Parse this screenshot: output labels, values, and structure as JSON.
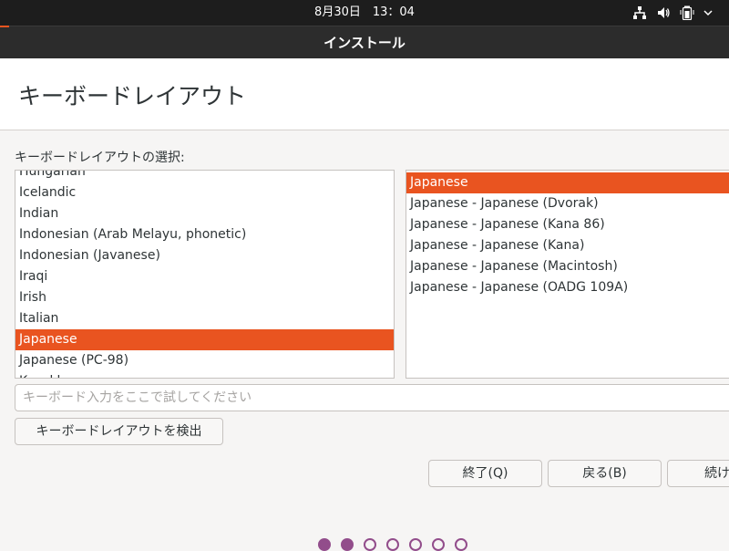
{
  "topbar": {
    "clock": "8月30日　13：04",
    "icons": [
      "network-icon",
      "volume-icon",
      "battery-icon",
      "chevron-down-icon"
    ]
  },
  "window": {
    "title": "インストール"
  },
  "page": {
    "title": "キーボードレイアウト"
  },
  "layout_section": {
    "label": "キーボードレイアウトの選択:"
  },
  "layout_list": {
    "items": [
      {
        "label": "Hungarian"
      },
      {
        "label": "Icelandic"
      },
      {
        "label": "Indian"
      },
      {
        "label": "Indonesian (Arab Melayu, phonetic)"
      },
      {
        "label": "Indonesian (Javanese)"
      },
      {
        "label": "Iraqi"
      },
      {
        "label": "Irish"
      },
      {
        "label": "Italian"
      },
      {
        "label": "Japanese",
        "selected": true
      },
      {
        "label": "Japanese (PC-98)"
      },
      {
        "label": "Kazakh"
      }
    ]
  },
  "variant_list": {
    "items": [
      {
        "label": "Japanese",
        "selected": true
      },
      {
        "label": "Japanese - Japanese (Dvorak)"
      },
      {
        "label": "Japanese - Japanese (Kana 86)"
      },
      {
        "label": "Japanese - Japanese (Kana)"
      },
      {
        "label": "Japanese - Japanese (Macintosh)"
      },
      {
        "label": "Japanese - Japanese (OADG 109A)"
      }
    ]
  },
  "test_input": {
    "value": "",
    "placeholder": "キーボード入力をここで試してください"
  },
  "buttons": {
    "detect": "キーボードレイアウトを検出",
    "quit": "終了(Q)",
    "back": "戻る(B)",
    "continue": "続け"
  },
  "progress": {
    "total_steps": 7,
    "completed_steps": 2
  },
  "colors": {
    "accent": "#e95420",
    "progress_dot": "#924d8b",
    "topbar": "#1d1d1d",
    "titlebar": "#2c2c2c"
  }
}
